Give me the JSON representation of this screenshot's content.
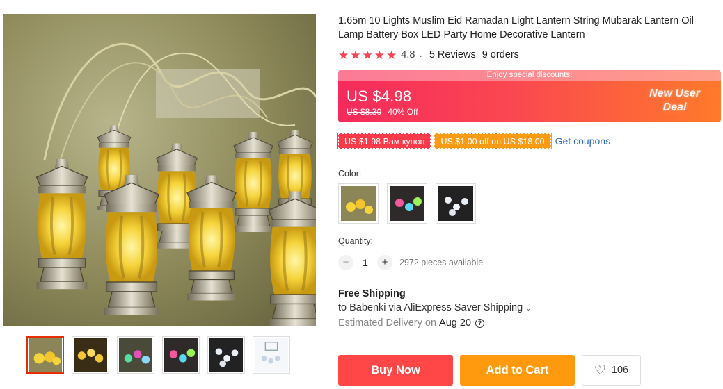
{
  "product": {
    "title": "1.65m 10 Lights Muslim Eid Ramadan Light Lantern String Mubarak Lantern Oil Lamp Battery Box LED Party Home Decorative Lantern",
    "rating_score": "4.8",
    "reviews": "5 Reviews",
    "orders": "9 orders"
  },
  "price": {
    "banner": "Enjoy special discounts!",
    "current": "US $4.98",
    "original": "US $8.30",
    "discount": "40% Off",
    "promo_line1": "New User",
    "promo_line2": "Deal",
    "colors": {
      "start": "#f62a5c",
      "end": "#ff7a2a"
    }
  },
  "coupons": {
    "items": [
      {
        "label": "US $1.98 Вам купон",
        "color": "#fc3a4a"
      },
      {
        "label": "US $1.00 off on US $18.00",
        "color": "#fb9a13"
      }
    ],
    "link": "Get coupons"
  },
  "options": {
    "color_label": "Color:",
    "swatches": [
      "warm-white-lanterns",
      "multicolor-lanterns",
      "white-lanterns"
    ]
  },
  "quantity": {
    "label": "Quantity:",
    "value": "1",
    "available": "2972 pieces available"
  },
  "shipping": {
    "title": "Free Shipping",
    "via": "to Babenki via AliExpress Saver Shipping",
    "estimated_label": "Estimated Delivery on",
    "estimated_date": "Aug 20"
  },
  "actions": {
    "buy": "Buy Now",
    "cart": "Add to Cart",
    "wishlist_count": "106",
    "colors": {
      "buy": "#ff4747",
      "cart": "#ff9a0e"
    }
  },
  "gallery": {
    "thumbnails": [
      "lanterns-closeup",
      "lanterns-warm",
      "lanterns-colorful",
      "lanterns-multicolor",
      "lanterns-white",
      "package-box"
    ],
    "active_index": 0
  }
}
